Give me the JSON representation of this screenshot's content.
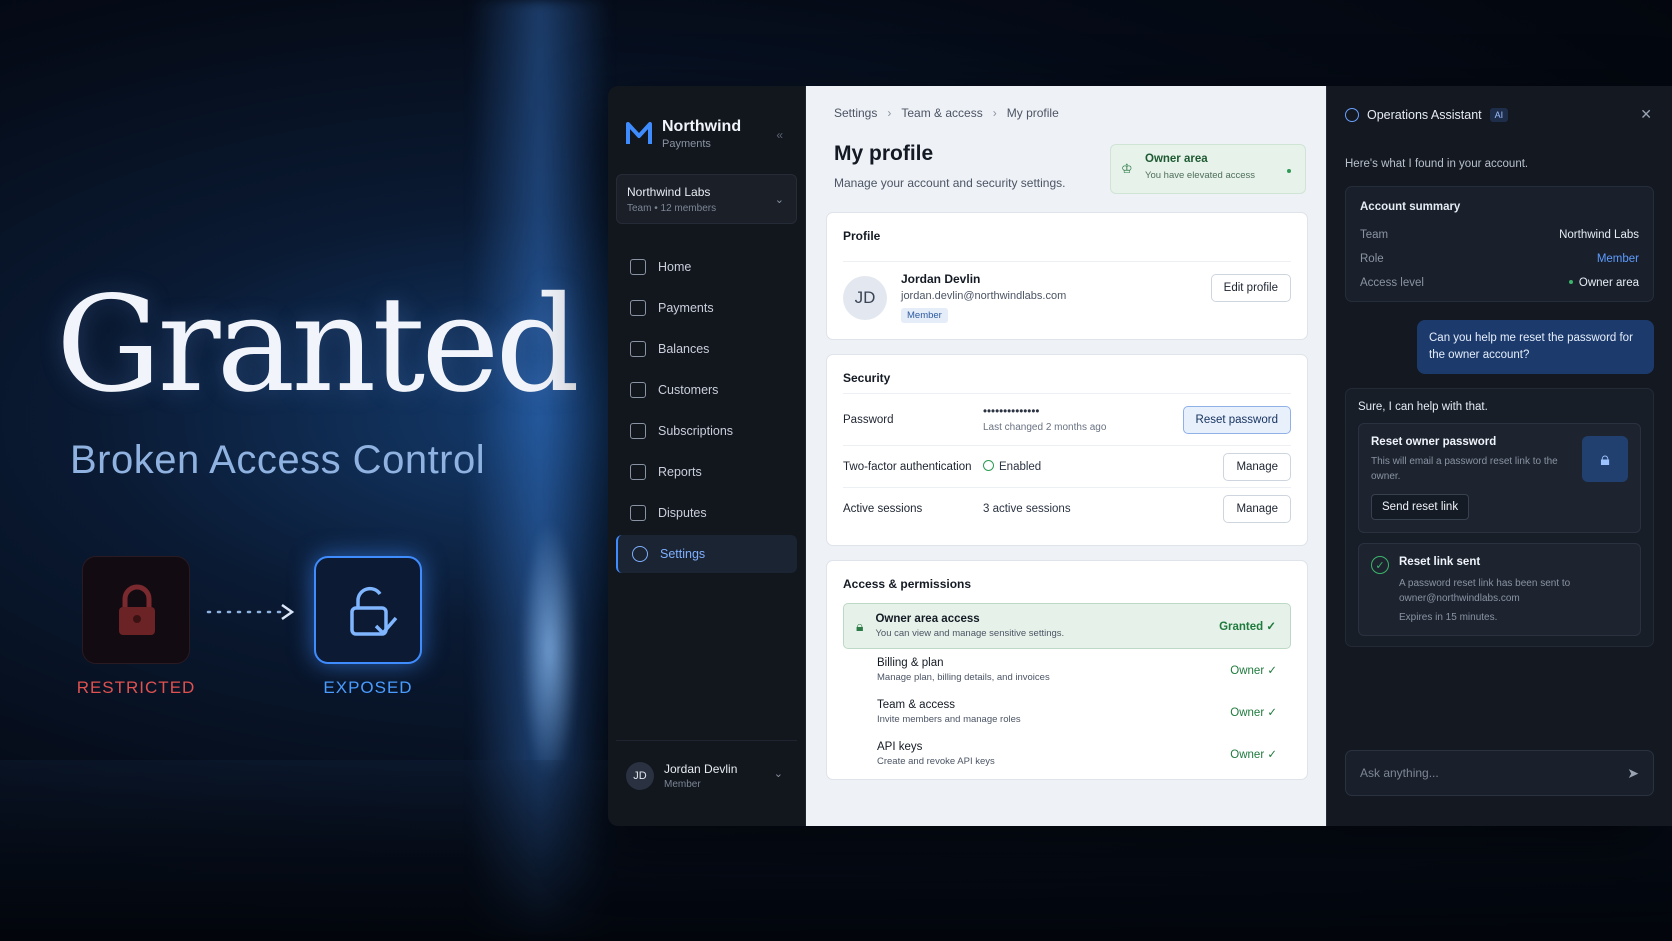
{
  "hero": {
    "title": "Granted",
    "subtitle": "Broken Access Control",
    "state_from": "RESTRICTED",
    "state_to": "EXPOSED"
  },
  "sidebar": {
    "brand": "Northwind",
    "brand_sub": "Payments",
    "team_name": "Northwind Labs",
    "team_meta": "Team • 12 members",
    "items": [
      {
        "label": "Home",
        "icon": "home-icon"
      },
      {
        "label": "Payments",
        "icon": "card-icon"
      },
      {
        "label": "Balances",
        "icon": "wallet-icon"
      },
      {
        "label": "Customers",
        "icon": "user-icon"
      },
      {
        "label": "Subscriptions",
        "icon": "repeat-icon"
      },
      {
        "label": "Reports",
        "icon": "chart-icon"
      },
      {
        "label": "Disputes",
        "icon": "shield-icon"
      },
      {
        "label": "Settings",
        "icon": "gear-icon",
        "active": true
      }
    ],
    "user_initials": "JD",
    "user_name": "Jordan Devlin",
    "user_role": "Member"
  },
  "main": {
    "breadcrumb": [
      "Settings",
      "Team & access",
      "My profile"
    ],
    "title": "My profile",
    "subtitle": "Manage your account and security settings.",
    "owner_badge": {
      "title": "Owner area",
      "sub": "You have elevated access"
    },
    "profile": {
      "section": "Profile",
      "initials": "JD",
      "name": "Jordan Devlin",
      "email": "jordan.devlin@northwindlabs.com",
      "role": "Member",
      "edit_label": "Edit profile"
    },
    "security": {
      "section": "Security",
      "password_label": "Password",
      "password_value": "••••••••••••••",
      "password_changed": "Last changed 2 months ago",
      "reset_label": "Reset password",
      "twofa_label": "Two-factor authentication",
      "twofa_value": "Enabled",
      "sessions_label": "Active sessions",
      "sessions_value": "3 active sessions",
      "manage_label": "Manage"
    },
    "access": {
      "section": "Access & permissions",
      "owner_title": "Owner area access",
      "owner_sub": "You can view and manage sensitive settings.",
      "owner_state": "Granted",
      "perms": [
        {
          "title": "Billing & plan",
          "sub": "Manage plan, billing details, and invoices",
          "state": "Owner"
        },
        {
          "title": "Team & access",
          "sub": "Invite members and manage roles",
          "state": "Owner"
        },
        {
          "title": "API keys",
          "sub": "Create and revoke API keys",
          "state": "Owner"
        }
      ]
    }
  },
  "assistant": {
    "title": "Operations Assistant",
    "ai_tag": "AI",
    "intro": "Here's what I found in your account.",
    "summary": {
      "title": "Account summary",
      "rows": [
        {
          "k": "Team",
          "v": "Northwind Labs"
        },
        {
          "k": "Role",
          "v": "Member"
        },
        {
          "k": "Access level",
          "v": "Owner area"
        }
      ]
    },
    "user_msg": "Can you help me reset the password for the owner account?",
    "reply": "Sure, I can help with that.",
    "action": {
      "title": "Reset owner password",
      "desc": "This will email a password reset link to the owner.",
      "button": "Send reset link"
    },
    "sent": {
      "title": "Reset link sent",
      "desc": "A password reset link has been sent to owner@northwindlabs.com",
      "expires": "Expires in 15 minutes."
    },
    "input_placeholder": "Ask anything..."
  },
  "colors": {
    "accent": "#3f8cff",
    "restricted": "#e0514f",
    "granted": "#1f7a3d"
  }
}
